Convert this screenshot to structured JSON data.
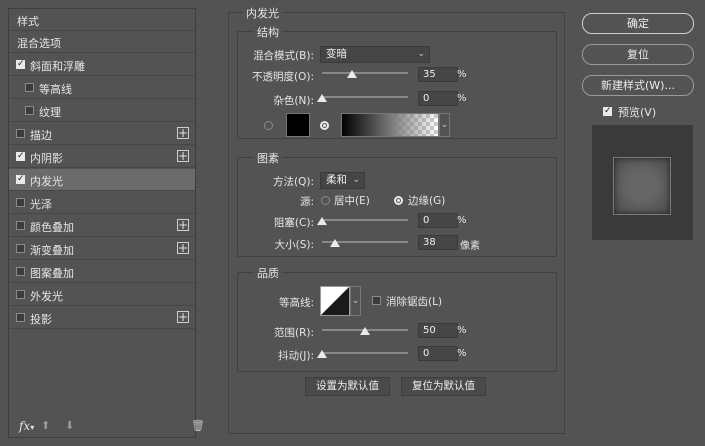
{
  "left_panel": {
    "header": "样式",
    "items": [
      {
        "label": "混合选项",
        "checkbox": false,
        "checked": false,
        "plus": false,
        "selected": false,
        "indent": false
      },
      {
        "label": "斜面和浮雕",
        "checkbox": true,
        "checked": true,
        "plus": false,
        "selected": false,
        "indent": false
      },
      {
        "label": "等高线",
        "checkbox": true,
        "checked": false,
        "plus": false,
        "selected": false,
        "indent": true
      },
      {
        "label": "纹理",
        "checkbox": true,
        "checked": false,
        "plus": false,
        "selected": false,
        "indent": true
      },
      {
        "label": "描边",
        "checkbox": true,
        "checked": false,
        "plus": true,
        "selected": false,
        "indent": false
      },
      {
        "label": "内阴影",
        "checkbox": true,
        "checked": true,
        "plus": true,
        "selected": false,
        "indent": false
      },
      {
        "label": "内发光",
        "checkbox": true,
        "checked": true,
        "plus": false,
        "selected": true,
        "indent": false
      },
      {
        "label": "光泽",
        "checkbox": true,
        "checked": false,
        "plus": false,
        "selected": false,
        "indent": false
      },
      {
        "label": "颜色叠加",
        "checkbox": true,
        "checked": false,
        "plus": true,
        "selected": false,
        "indent": false
      },
      {
        "label": "渐变叠加",
        "checkbox": true,
        "checked": false,
        "plus": true,
        "selected": false,
        "indent": false
      },
      {
        "label": "图案叠加",
        "checkbox": true,
        "checked": false,
        "plus": false,
        "selected": false,
        "indent": false
      },
      {
        "label": "外发光",
        "checkbox": true,
        "checked": false,
        "plus": false,
        "selected": false,
        "indent": false
      },
      {
        "label": "投影",
        "checkbox": true,
        "checked": false,
        "plus": true,
        "selected": false,
        "indent": false
      }
    ],
    "fx_label": "fx"
  },
  "inner_glow": {
    "title": "内发光",
    "structure": {
      "title": "结构",
      "blend_mode_label": "混合模式(B):",
      "blend_mode_value": "变暗",
      "opacity_label": "不透明度(O):",
      "opacity_value": "35",
      "opacity_level": 35,
      "noise_label": "杂色(N):",
      "noise_value": "0",
      "noise_level": 0,
      "percent": "%"
    },
    "elements": {
      "title": "图素",
      "method_label": "方法(Q):",
      "method_value": "柔和",
      "source_label": "源:",
      "center_label": "居中(E)",
      "edge_label": "边缘(G)",
      "source_value": "edge",
      "choke_label": "阻塞(C):",
      "choke_value": "0",
      "choke_level": 0,
      "size_label": "大小(S):",
      "size_value": "38",
      "size_level": 15,
      "size_unit": "像素",
      "percent": "%"
    },
    "quality": {
      "title": "品质",
      "contour_label": "等高线:",
      "antialias_label": "消除锯齿(L)",
      "range_label": "范围(R):",
      "range_value": "50",
      "range_level": 50,
      "jitter_label": "抖动(J):",
      "jitter_value": "0",
      "jitter_level": 0,
      "percent": "%"
    },
    "make_default_label": "设置为默认值",
    "reset_default_label": "复位为默认值"
  },
  "right_panel": {
    "ok_label": "确定",
    "reset_label": "复位",
    "new_style_label": "新建样式(W)...",
    "preview_label": "预览(V)",
    "preview_checked": true
  },
  "colors": {
    "background": "#535353",
    "selected_row": "#6b6b6b",
    "glow_color": "#000000"
  }
}
